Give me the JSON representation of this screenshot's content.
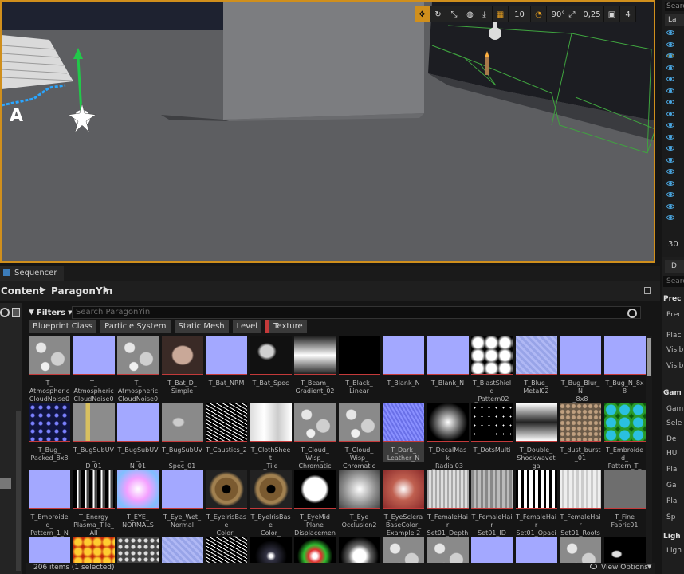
{
  "viewport": {
    "toolbar": {
      "grid_snap": "10",
      "rotation_snap": "90°",
      "scale_snap": "0,25",
      "camera_speed": "4"
    }
  },
  "outliner": {
    "search_placeholder": "Searc",
    "column_label": "La",
    "footer": "30 a"
  },
  "details": {
    "tab_label": "D",
    "search_placeholder": "Search",
    "sections": [
      {
        "label": "Prec"
      },
      {
        "label": "Prec"
      },
      {
        "label": "Plac"
      },
      {
        "label": "Visib"
      },
      {
        "label": "Visib"
      },
      {
        "label": "Gam"
      },
      {
        "label": "Gam"
      },
      {
        "label": "Sele"
      },
      {
        "label": "De"
      },
      {
        "label": "HU"
      },
      {
        "label": "Pla"
      },
      {
        "label": "Ga"
      },
      {
        "label": "Pla"
      },
      {
        "label": "Sp"
      },
      {
        "label": "Ligh"
      },
      {
        "label": "Ligh"
      }
    ]
  },
  "sequencer": {
    "tab_label": "Sequencer"
  },
  "content_browser": {
    "breadcrumb_root": "Content",
    "breadcrumb_folder": "ParagonYin",
    "filters_label": "Filters",
    "search_placeholder": "Search ParagonYin",
    "type_filters": [
      "Blueprint Class",
      "Particle System",
      "Static Mesh",
      "Level",
      "Texture"
    ],
    "items": [
      {
        "label": "T_\nAtmospheric\nCloudNoise01",
        "thumb": "noise-gray"
      },
      {
        "label": "T_\nAtmospheric\nCloudNoise01",
        "thumb": "normal"
      },
      {
        "label": "T_\nAtmospheric\nCloudNoise03",
        "thumb": "noise-gray"
      },
      {
        "label": "T_Bat_D_\nSimple",
        "thumb": "bat"
      },
      {
        "label": "T_Bat_NRM",
        "thumb": "normal"
      },
      {
        "label": "T_Bat_Spec",
        "thumb": "dark-shape"
      },
      {
        "label": "T_Beam_\nGradient_02",
        "thumb": "hgrad"
      },
      {
        "label": "T_Black_\nLinear",
        "thumb": "black"
      },
      {
        "label": "T_Blank_N",
        "thumb": "normal"
      },
      {
        "label": "T_Blank_N",
        "thumb": "normal"
      },
      {
        "label": "T_BlastShield\n_Pattern02",
        "thumb": "dots-bw"
      },
      {
        "label": "T_Blue_\nMetal02",
        "thumb": "normal-noise"
      },
      {
        "label": "T_Bug_Blur_N\n_8x8",
        "thumb": "normal"
      },
      {
        "label": "T_Bug_N_8x8",
        "thumb": "normal"
      },
      {
        "label": "T_Bug_\nPacked_8x8",
        "thumb": "bug-packed"
      },
      {
        "label": "T_BugSubUV_\nD_01",
        "thumb": "bugsub"
      },
      {
        "label": "T_BugSubUV_\nN_01",
        "thumb": "normal"
      },
      {
        "label": "T_BugSubUV_\nSpec_01",
        "thumb": "bugsub-gray"
      },
      {
        "label": "T_Caustics_2",
        "thumb": "caustics"
      },
      {
        "label": "T_ClothSheet\n_Tile",
        "thumb": "cloth"
      },
      {
        "label": "T_Cloud_\nWisp_\nChromatic",
        "thumb": "noise-gray"
      },
      {
        "label": "T_Cloud_\nWisp_\nChromatic",
        "thumb": "noise-gray"
      },
      {
        "label": "T_Dark_\nLeather_N",
        "thumb": "leather-n",
        "selected": true
      },
      {
        "label": "T_DecalMask\n_Radial03",
        "thumb": "radial"
      },
      {
        "label": "T_DotsMulti",
        "thumb": "stars"
      },
      {
        "label": "T_Double_\nShockwavetga",
        "thumb": "vgrad"
      },
      {
        "label": "T_dust_burst\n_01",
        "thumb": "dust"
      },
      {
        "label": "T_Embroided_\nPattern_T_\nMASKS",
        "thumb": "embroid"
      },
      {
        "label": "T_Embroided_\nPattern_1_N",
        "thumb": "normal"
      },
      {
        "label": "T_Energy\nPlasma_Tile_\nAll",
        "thumb": "plasma"
      },
      {
        "label": "T_EYE_\nNORMALS",
        "thumb": "eye-normals"
      },
      {
        "label": "T_Eye_Wet_\nNormal",
        "thumb": "normal"
      },
      {
        "label": "T_EyelrisBase\nColor_\nExample 2",
        "thumb": "iris"
      },
      {
        "label": "T_EyelrisBase\nColor_\nExample 3",
        "thumb": "iris"
      },
      {
        "label": "T_EyeMid\nPlane\nDisplacement",
        "thumb": "eye-mid"
      },
      {
        "label": "T_Eye\nOcclusion2",
        "thumb": "radial-soft"
      },
      {
        "label": "T_EyeSclera\nBaseColor_\nExample 2",
        "thumb": "sclera"
      },
      {
        "label": "T_FemaleHair\nSet01_Depth",
        "thumb": "hair-gray"
      },
      {
        "label": "T_FemaleHair\nSet01_ID",
        "thumb": "hair-gray2"
      },
      {
        "label": "T_FemaleHair\nSet01_Opacity",
        "thumb": "hair-bw"
      },
      {
        "label": "T_FemaleHair\nSet01_Roots",
        "thumb": "hair-light"
      },
      {
        "label": "T_Fine\nFabric01",
        "thumb": "fabric"
      },
      {
        "label": "",
        "thumb": "normal"
      },
      {
        "label": "",
        "thumb": "lava"
      },
      {
        "label": "",
        "thumb": "dots-gray"
      },
      {
        "label": "",
        "thumb": "normal-noise"
      },
      {
        "label": "",
        "thumb": "caustics"
      },
      {
        "label": "",
        "thumb": "star-burst"
      },
      {
        "label": "",
        "thumb": "rainbow"
      },
      {
        "label": "",
        "thumb": "burst"
      },
      {
        "label": "",
        "thumb": "noise-gray"
      },
      {
        "label": "",
        "thumb": "noise-gray"
      },
      {
        "label": "",
        "thumb": "normal"
      },
      {
        "label": "",
        "thumb": "normal"
      },
      {
        "label": "",
        "thumb": "noise-gray"
      },
      {
        "label": "",
        "thumb": "faces"
      }
    ],
    "status_text": "206 items (1 selected)",
    "view_options": "View Options"
  }
}
